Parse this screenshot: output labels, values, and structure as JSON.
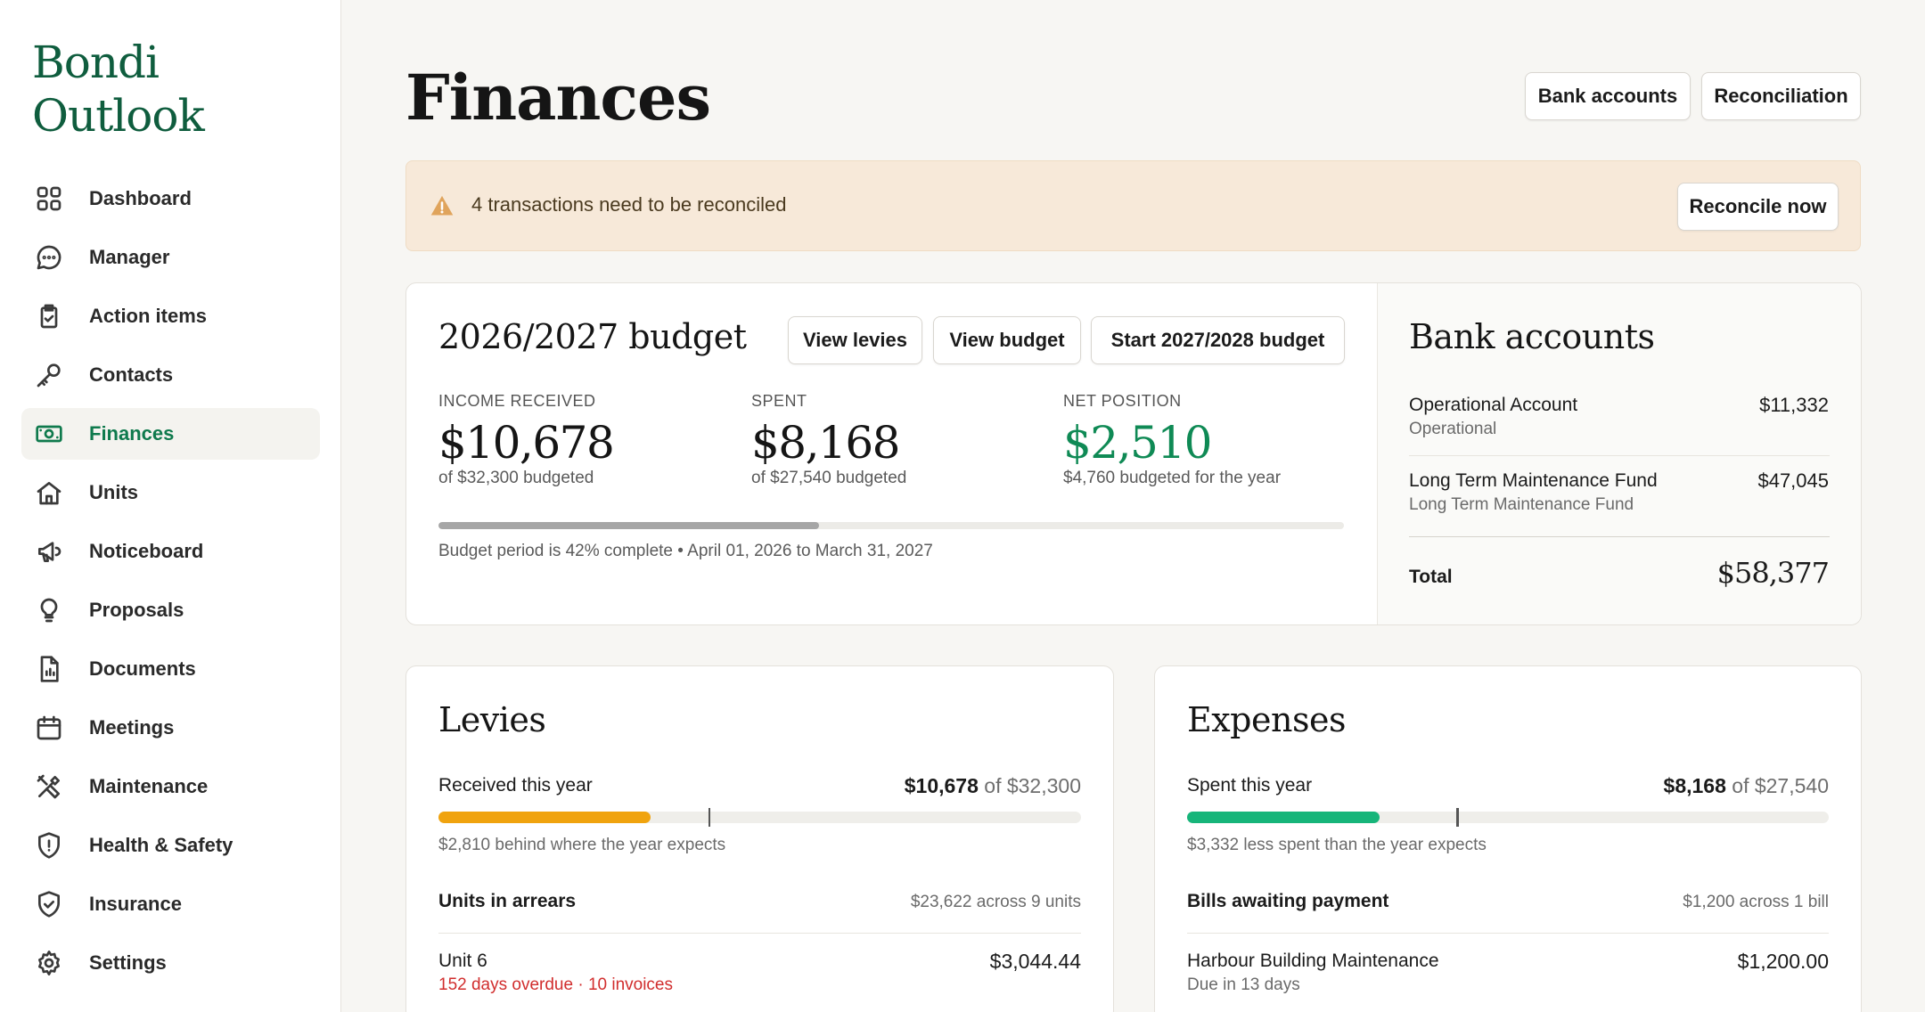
{
  "brand": {
    "line1": "Bondi",
    "line2": "Outlook"
  },
  "sidebar": {
    "items": [
      {
        "label": "Dashboard",
        "icon": "grid-icon"
      },
      {
        "label": "Manager",
        "icon": "chat-icon"
      },
      {
        "label": "Action items",
        "icon": "clipboard-check-icon"
      },
      {
        "label": "Contacts",
        "icon": "key-icon"
      },
      {
        "label": "Finances",
        "icon": "money-icon",
        "active": true
      },
      {
        "label": "Units",
        "icon": "home-icon"
      },
      {
        "label": "Noticeboard",
        "icon": "megaphone-icon"
      },
      {
        "label": "Proposals",
        "icon": "lightbulb-icon"
      },
      {
        "label": "Documents",
        "icon": "document-icon"
      },
      {
        "label": "Meetings",
        "icon": "calendar-icon"
      },
      {
        "label": "Maintenance",
        "icon": "tools-icon"
      },
      {
        "label": "Health & Safety",
        "icon": "shield-alert-icon"
      },
      {
        "label": "Insurance",
        "icon": "shield-check-icon"
      },
      {
        "label": "Settings",
        "icon": "gear-icon"
      }
    ]
  },
  "header": {
    "title": "Finances",
    "bank_accounts_label": "Bank accounts",
    "reconciliation_label": "Reconciliation"
  },
  "alert": {
    "text": "4 transactions need to be reconciled",
    "action_label": "Reconcile now"
  },
  "budget": {
    "title": "2026/2027 budget",
    "view_levies_label": "View levies",
    "view_budget_label": "View budget",
    "start_next_label": "Start 2027/2028 budget",
    "income": {
      "label": "INCOME RECEIVED",
      "value": "$10,678",
      "sub": "of $32,300 budgeted"
    },
    "spent": {
      "label": "SPENT",
      "value": "$8,168",
      "sub": "of $27,540 budgeted"
    },
    "net": {
      "label": "NET POSITION",
      "value": "$2,510",
      "sub": "$4,760 budgeted for the year"
    },
    "period_progress": 0.42,
    "period_text": "Budget period is 42% complete • April 01, 2026 to March 31, 2027"
  },
  "bank_accounts": {
    "title": "Bank accounts",
    "accounts": [
      {
        "name": "Operational Account",
        "type": "Operational",
        "balance": "$11,332"
      },
      {
        "name": "Long Term Maintenance Fund",
        "type": "Long Term Maintenance Fund",
        "balance": "$47,045"
      }
    ],
    "total_label": "Total",
    "total_value": "$58,377"
  },
  "levies": {
    "title": "Levies",
    "received_label": "Received this year",
    "received_amount": "$10,678",
    "received_of": "of $32,300",
    "progress": 0.33,
    "expected": 0.42,
    "bar_color": "#f0a30e",
    "note": "$2,810 behind where the year expects",
    "arrears_label": "Units in arrears",
    "arrears_summary": "$23,622 across 9 units",
    "unit_name": "Unit 6",
    "unit_amount": "$3,044.44",
    "unit_note": "152 days overdue · 10 invoices"
  },
  "expenses": {
    "title": "Expenses",
    "spent_label": "Spent this year",
    "spent_amount": "$8,168",
    "spent_of": "of $27,540",
    "progress": 0.3,
    "expected": 0.42,
    "bar_color": "#17b57a",
    "note": "$3,332 less spent than the year expects",
    "bills_label": "Bills awaiting payment",
    "bills_summary": "$1,200 across 1 bill",
    "bill_name": "Harbour Building Maintenance",
    "bill_amount": "$1,200.00",
    "bill_note": "Due in 13 days"
  },
  "colors": {
    "brand": "#0f5d3e",
    "accent": "#0f7a4d",
    "positive": "#0f8a55",
    "alert_bg": "#f7e9d9",
    "overdue": "#d12e2e"
  }
}
